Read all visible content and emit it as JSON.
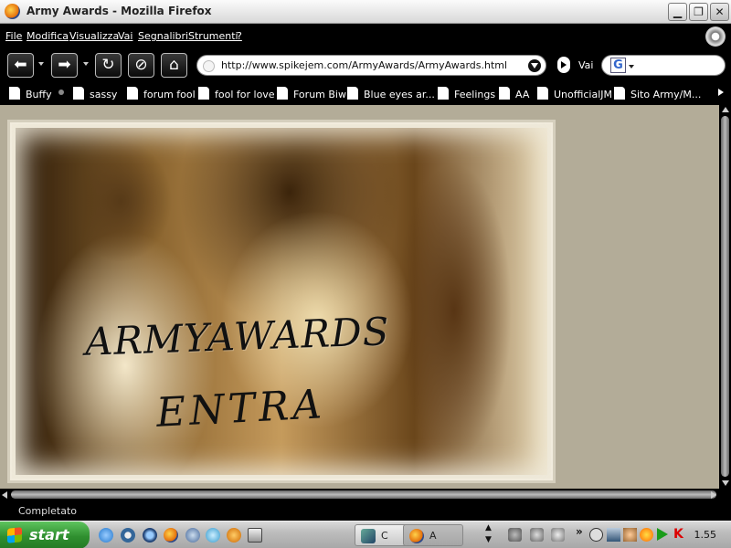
{
  "window": {
    "title": "Army Awards - Mozilla Firefox"
  },
  "menu": [
    "File",
    "Modifica",
    "Visualizza",
    "Vai",
    "Segnalibri",
    "Strumenti",
    "?"
  ],
  "navigation": {
    "url": "http://www.spikejem.com/ArmyAwards/ArmyAwards.html",
    "go_label": "Vai",
    "search_engine_letter": "G"
  },
  "bookmarks": [
    "Buffy",
    "sassy",
    "forum fool",
    "fool for love",
    "Forum Biw",
    "Blue eyes ar...",
    "Feelings",
    "AA",
    "UnofficialJM",
    "Sito Army/M..."
  ],
  "content": {
    "banner_title": "ARMYAWARDS",
    "enter_link": "ENTRA"
  },
  "status": {
    "text": "Completato"
  },
  "taskbar": {
    "start_label": "start",
    "tasks": [
      {
        "label": "C"
      },
      {
        "label": "A"
      }
    ],
    "clock": "1.55"
  },
  "colors": {
    "content_bg": "#b3ac98",
    "start_green": "#2f8f2f"
  }
}
